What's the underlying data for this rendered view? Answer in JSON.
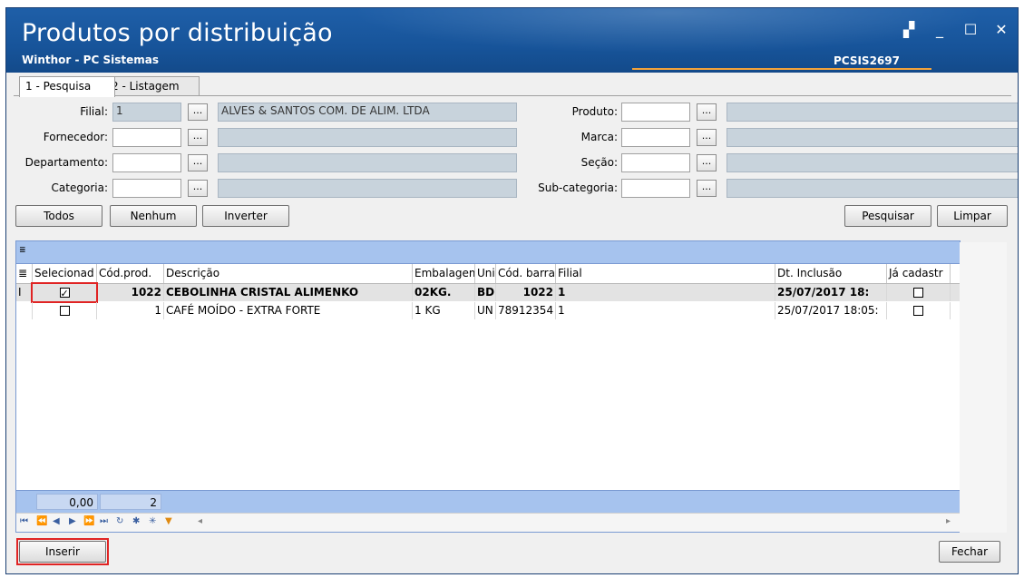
{
  "window": {
    "title": "Produtos por distribuição",
    "subtitle": "Winthor - PC Sistemas",
    "code": "PCSIS2697",
    "buttons": [
      "▞",
      "_",
      "☐",
      "✕"
    ]
  },
  "tabs": [
    {
      "label": "1 - Pesquisa",
      "active": true
    },
    {
      "label": "2 - Listagem",
      "active": false
    }
  ],
  "filters": {
    "filial": {
      "label": "Filial:",
      "code": "1",
      "desc": "ALVES & SANTOS COM. DE ALIM. LTDA"
    },
    "fornecedor": {
      "label": "Fornecedor:",
      "code": "",
      "desc": ""
    },
    "departamento": {
      "label": "Departamento:",
      "code": "",
      "desc": ""
    },
    "categoria": {
      "label": "Categoria:",
      "code": "",
      "desc": ""
    },
    "produto": {
      "label": "Produto:",
      "code": "",
      "desc": ""
    },
    "marca": {
      "label": "Marca:",
      "code": "",
      "desc": ""
    },
    "secao": {
      "label": "Seção:",
      "code": "",
      "desc": ""
    },
    "subcategoria": {
      "label": "Sub-categoria:",
      "code": "",
      "desc": ""
    },
    "ellipsis": "..."
  },
  "actions": {
    "todos": "Todos",
    "nenhum": "Nenhum",
    "inverter": "Inverter",
    "pesquisar": "Pesquisar",
    "limpar": "Limpar"
  },
  "grid": {
    "columns": [
      "Selecionad",
      "Cód.prod.",
      "Descrição",
      "Embalagem",
      "Uni",
      "Cód. barra",
      "Filial",
      "Dt. Inclusão",
      "Já cadastr"
    ],
    "rows": [
      {
        "selected": true,
        "cod": "1022",
        "descricao": "CEBOLINHA CRISTAL ALIMENKO",
        "embalagem": "02KG.",
        "uni": "BD",
        "barra": "1022",
        "filial": "1",
        "dt": "25/07/2017 18:",
        "ja": false
      },
      {
        "selected": false,
        "cod": "1",
        "descricao": "CAFÉ MOÍDO - EXTRA FORTE",
        "embalagem": "1 KG",
        "uni": "UN",
        "barra": "78912354",
        "filial": "1",
        "dt": "25/07/2017 18:05:",
        "ja": false
      }
    ],
    "footer": {
      "total": "0,00",
      "count": "2"
    },
    "row_indicator": "I"
  },
  "bottom": {
    "inserir": "Inserir",
    "fechar": "Fechar"
  }
}
